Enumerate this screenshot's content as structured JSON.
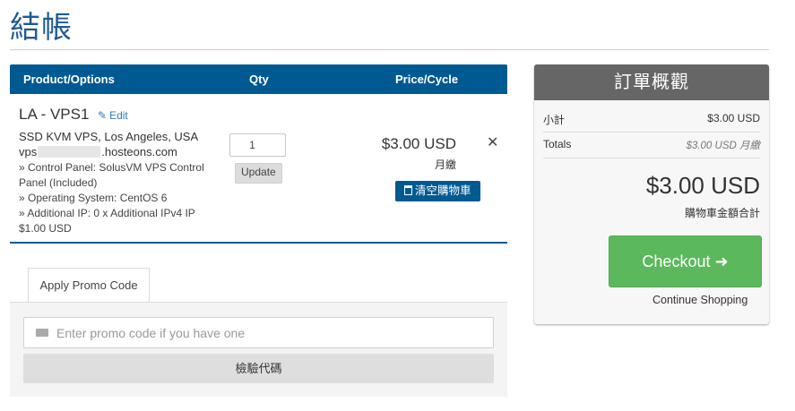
{
  "page": {
    "title": "結帳"
  },
  "cart": {
    "headers": {
      "product": "Product/Options",
      "qty": "Qty",
      "price": "Price/Cycle"
    },
    "item": {
      "name": "LA - VPS1",
      "edit_label": "Edit",
      "description": "SSD KVM VPS, Los Angeles, USA",
      "host_prefix": "vps",
      "host_suffix": ".hosteons.com",
      "options": "» Control Panel: SolusVM VPS Control Panel (Included)\n» Operating System: CentOS 6\n» Additional IP: 0 x Additional IPv4 IP $1.00 USD",
      "qty": "1",
      "update_label": "Update",
      "price": "$3.00 USD",
      "cycle": "月繳",
      "remove_icon": "close-icon"
    },
    "empty_cart_label": "清空購物車"
  },
  "promo": {
    "tab_label": "Apply Promo Code",
    "placeholder": "Enter promo code if you have one",
    "validate_label": "檢驗代碼"
  },
  "summary": {
    "title": "訂單概觀",
    "subtotal_label": "小計",
    "subtotal_value": "$3.00 USD",
    "totals_label": "Totals",
    "totals_value": "$3.00 USD 月繳",
    "total_amount": "$3.00 USD",
    "total_caption": "購物車金額合計",
    "checkout_label": "Checkout",
    "continue_label": "Continue Shopping"
  },
  "colors": {
    "primary": "#005a92",
    "title": "#1f5a92",
    "checkout": "#5cb85c",
    "summary_header": "#666666"
  }
}
